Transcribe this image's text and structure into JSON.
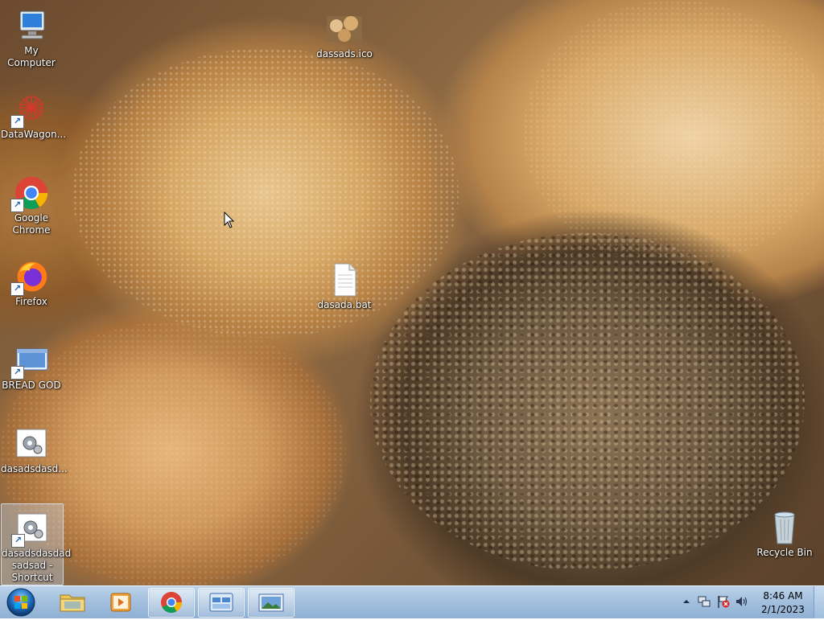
{
  "desktop": {
    "icons": [
      {
        "label": "My Computer"
      },
      {
        "label": "DataWagon..."
      },
      {
        "label": "Google Chrome"
      },
      {
        "label": "Firefox"
      },
      {
        "label": "BREAD GOD"
      },
      {
        "label": "dasadsdasd..."
      },
      {
        "label": "dasadsdasdad sadsad - Shortcut"
      },
      {
        "label": "dassads.ico"
      },
      {
        "label": "dasada.bat"
      },
      {
        "label": "Recycle Bin"
      }
    ]
  },
  "taskbar": {
    "start_icon": "windows-logo-icon",
    "pinned": [
      {
        "name": "windows-explorer",
        "icon": "folder-icon"
      },
      {
        "name": "media-player",
        "icon": "media-player-icon"
      },
      {
        "name": "google-chrome",
        "icon": "chrome-icon"
      },
      {
        "name": "app-window",
        "icon": "app-window-icon"
      },
      {
        "name": "image-viewer",
        "icon": "picture-icon"
      }
    ],
    "tray": {
      "icons": [
        "show-hidden-icons",
        "network-icon",
        "action-center-flag-icon",
        "volume-icon"
      ]
    },
    "clock": {
      "time": "8:46 AM",
      "date": "2/1/2023"
    }
  },
  "colors": {
    "taskbar": "#a4c0de",
    "selection": "#c8e1ff"
  }
}
